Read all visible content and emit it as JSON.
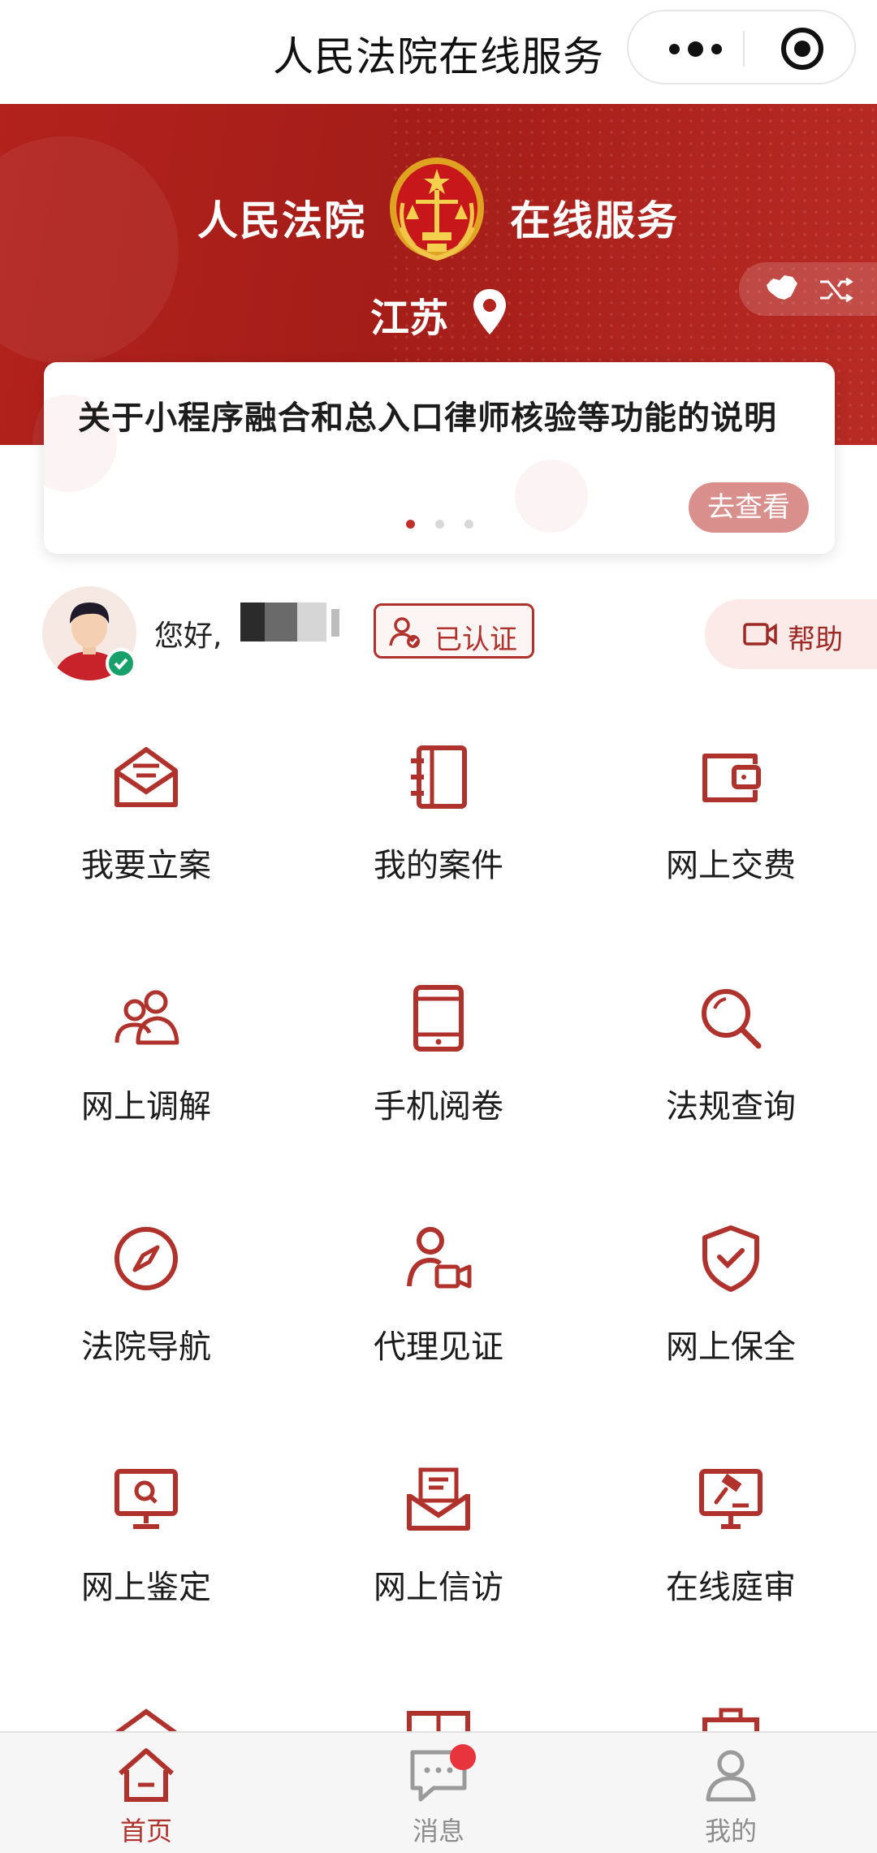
{
  "titlebar": {
    "title": "人民法院在线服务",
    "menu_icon": "more-dots-icon",
    "close_icon": "target-icon"
  },
  "banner": {
    "brand_left": "人民法院",
    "brand_right": "在线服务",
    "emblem_icon": "court-emblem-icon",
    "region": "江苏",
    "location_icon": "location-pin-icon",
    "switch_icons": [
      "china-map-icon",
      "shuffle-icon"
    ],
    "background_color": "#a41d18"
  },
  "notice": {
    "text": "关于小程序融合和总入口律师核验等功能的说明",
    "button_label": "去查看",
    "pages": 3,
    "active_page": 1
  },
  "user": {
    "greeting": "您好,",
    "name_masked": true,
    "verified_label": "已认证",
    "help_label": "帮助"
  },
  "services": [
    {
      "label": "我要立案",
      "icon": "envelope-open-icon"
    },
    {
      "label": "我的案件",
      "icon": "notebook-icon"
    },
    {
      "label": "网上交费",
      "icon": "wallet-icon"
    },
    {
      "label": "网上调解",
      "icon": "users-icon"
    },
    {
      "label": "手机阅卷",
      "icon": "tablet-icon"
    },
    {
      "label": "法规查询",
      "icon": "magnifier-icon"
    },
    {
      "label": "法院导航",
      "icon": "compass-icon"
    },
    {
      "label": "代理见证",
      "icon": "user-video-icon"
    },
    {
      "label": "网上保全",
      "icon": "shield-check-icon"
    },
    {
      "label": "网上鉴定",
      "icon": "monitor-search-icon"
    },
    {
      "label": "网上信访",
      "icon": "letter-icon"
    },
    {
      "label": "在线庭审",
      "icon": "gavel-screen-icon"
    }
  ],
  "tabbar": {
    "items": [
      {
        "label": "首页",
        "icon": "home-icon",
        "active": true
      },
      {
        "label": "消息",
        "icon": "message-icon",
        "active": false,
        "unread_dot": true
      },
      {
        "label": "我的",
        "icon": "person-icon",
        "active": false
      }
    ]
  },
  "colors": {
    "accent": "#b0322c",
    "banner": "#a41d18",
    "tab_inactive": "#8c8c8c",
    "verified": "#18a06a",
    "unread": "#e8343c"
  }
}
